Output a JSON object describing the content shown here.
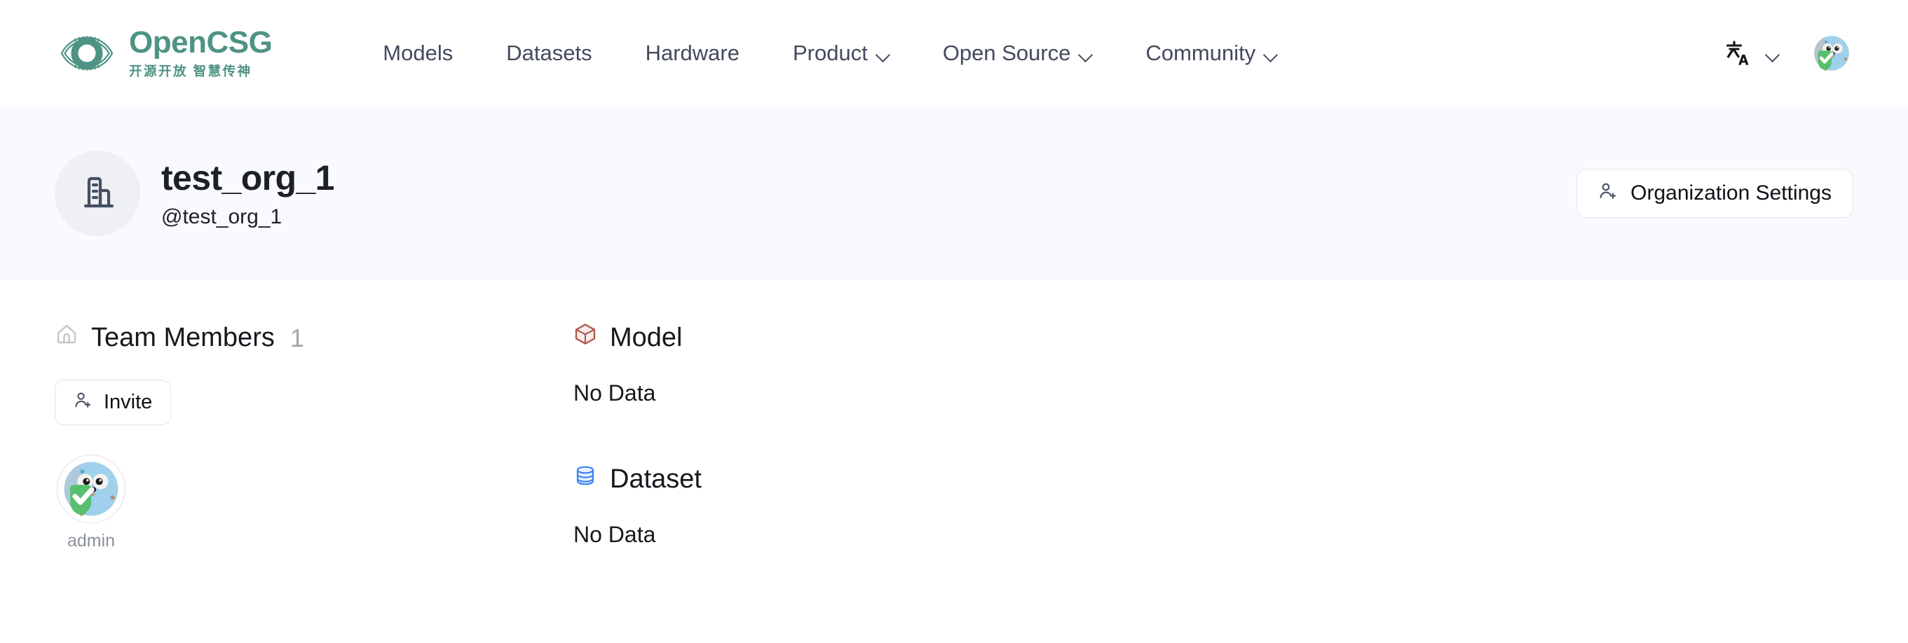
{
  "header": {
    "brand": {
      "name": "OpenCSG",
      "tagline": "开源开放 智慧传神",
      "logo_icon": "opencsg-eye-logo",
      "accent_color": "#4e9384"
    },
    "nav": [
      {
        "label": "Models",
        "has_dropdown": false
      },
      {
        "label": "Datasets",
        "has_dropdown": false
      },
      {
        "label": "Hardware",
        "has_dropdown": false
      },
      {
        "label": "Product",
        "has_dropdown": true
      },
      {
        "label": "Open Source",
        "has_dropdown": true
      },
      {
        "label": "Community",
        "has_dropdown": true
      }
    ],
    "language_switcher": {
      "icon": "translate-icon",
      "chevron": "chevron-down-icon"
    },
    "user_avatar": {
      "icon": "gopher-shield-avatar",
      "alt": "admin"
    }
  },
  "org": {
    "avatar_icon": "building-icon",
    "name": "test_org_1",
    "handle": "@test_org_1",
    "settings_button": {
      "label": "Organization Settings",
      "icon": "user-plus-icon"
    }
  },
  "members": {
    "title": "Team Members",
    "count": "1",
    "title_icon": "home-icon",
    "invite_button": {
      "label": "Invite",
      "icon": "user-plus-icon"
    },
    "list": [
      {
        "name": "admin",
        "avatar_icon": "gopher-shield-avatar"
      }
    ]
  },
  "repos": [
    {
      "title": "Model",
      "icon": "cube-icon",
      "icon_color": "#b2554a",
      "empty_text": "No Data"
    },
    {
      "title": "Dataset",
      "icon": "database-icon",
      "icon_color": "#3b82f6",
      "empty_text": "No Data"
    }
  ],
  "theme": {
    "banner_bg": "#f9fafd",
    "page_bg": "#ffffff",
    "text_primary": "#16181d",
    "text_muted": "#8c9199",
    "nav_text": "#434a5c"
  }
}
